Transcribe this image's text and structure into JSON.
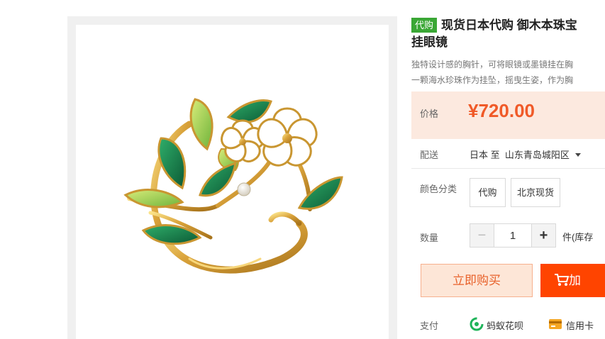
{
  "product": {
    "tag": "代购",
    "title_line1": "现货日本代购 御木本珠宝",
    "title_line2": "挂眼镜",
    "desc_line1": "独特设计感的胸针，可将眼镜或墨镜挂在胸",
    "desc_line2": "一颗海水珍珠作为挂坠，摇曳生姿，作为胸"
  },
  "price": {
    "label": "价格",
    "value": "¥720.00"
  },
  "shipping": {
    "label": "配送",
    "from": "日本",
    "to_word": "至",
    "destination": "山东青岛城阳区"
  },
  "options": {
    "label": "颜色分类",
    "items": [
      "代购",
      "北京现货"
    ]
  },
  "quantity": {
    "label": "数量",
    "value": "1",
    "minus": "−",
    "plus": "+",
    "stock": "件(库存"
  },
  "actions": {
    "buy_now": "立即购买",
    "add_cart": "加"
  },
  "payment": {
    "label": "支付",
    "methods": [
      "蚂蚁花呗",
      "信用卡"
    ]
  },
  "colors": {
    "accent": "#ff4400",
    "price": "#f05a28",
    "tag_bg": "#3aa735"
  }
}
